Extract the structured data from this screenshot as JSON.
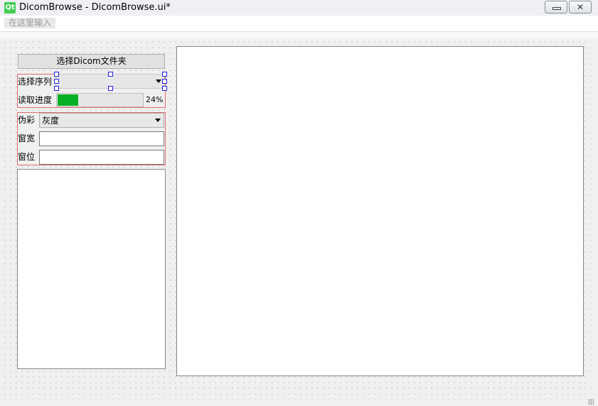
{
  "window": {
    "logo": "Qt",
    "title": "DicomBrowse - DicomBrowse.ui*",
    "minimize_icon": "minimize-icon",
    "close_icon": "close-icon",
    "close_glyph": "✕"
  },
  "menubar": {
    "placeholder": "在这里输入"
  },
  "controls": {
    "select_folder_label": "选择Dicom文件夹",
    "series_label": "选择序列",
    "series_value": "",
    "progress_label": "读取进度",
    "progress_percent": 24,
    "progress_text": "24%",
    "progress_color": "#06b025",
    "pseudo_color_label": "伪彩",
    "pseudo_color_value": "灰度",
    "window_width_label": "窗宽",
    "window_width_value": "",
    "window_level_label": "窗位",
    "window_level_value": ""
  },
  "colors": {
    "selection_border": "#e36b6b",
    "handle_border": "#2020e0"
  }
}
